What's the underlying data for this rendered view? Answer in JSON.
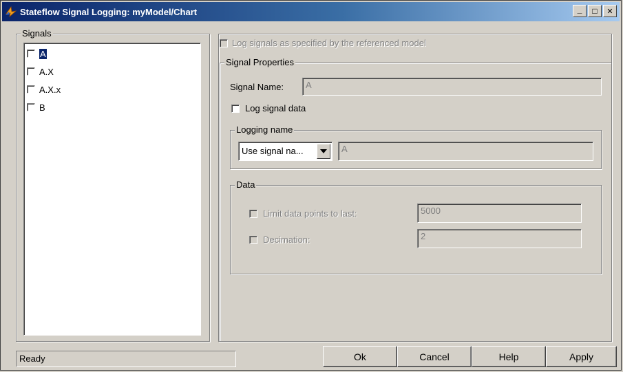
{
  "window": {
    "title": "Stateflow Signal Logging: myModel/Chart"
  },
  "caption_buttons": {
    "minimize": "_",
    "maximize": "□",
    "close": "✕"
  },
  "signals": {
    "legend": "Signals",
    "items": [
      {
        "label": "A",
        "checked": false,
        "selected": true
      },
      {
        "label": "A.X",
        "checked": false,
        "selected": false
      },
      {
        "label": "A.X.x",
        "checked": false,
        "selected": false
      },
      {
        "label": "B",
        "checked": false,
        "selected": false
      }
    ]
  },
  "log_referenced": {
    "label": "Log signals as specified by the referenced model"
  },
  "signal_properties": {
    "legend": "Signal Properties",
    "signal_name_label": "Signal Name:",
    "signal_name_value": "A",
    "log_signal_data_label": "Log signal data",
    "logging_name": {
      "legend": "Logging name",
      "select_value": "Use signal na...",
      "name_value": "A"
    },
    "data": {
      "legend": "Data",
      "limit_label": "Limit data points to last:",
      "limit_value": "5000",
      "decimation_label": "Decimation:",
      "decimation_value": "2"
    }
  },
  "status": {
    "text": "Ready"
  },
  "buttons": {
    "ok": "Ok",
    "cancel": "Cancel",
    "help": "Help",
    "apply": "Apply"
  }
}
